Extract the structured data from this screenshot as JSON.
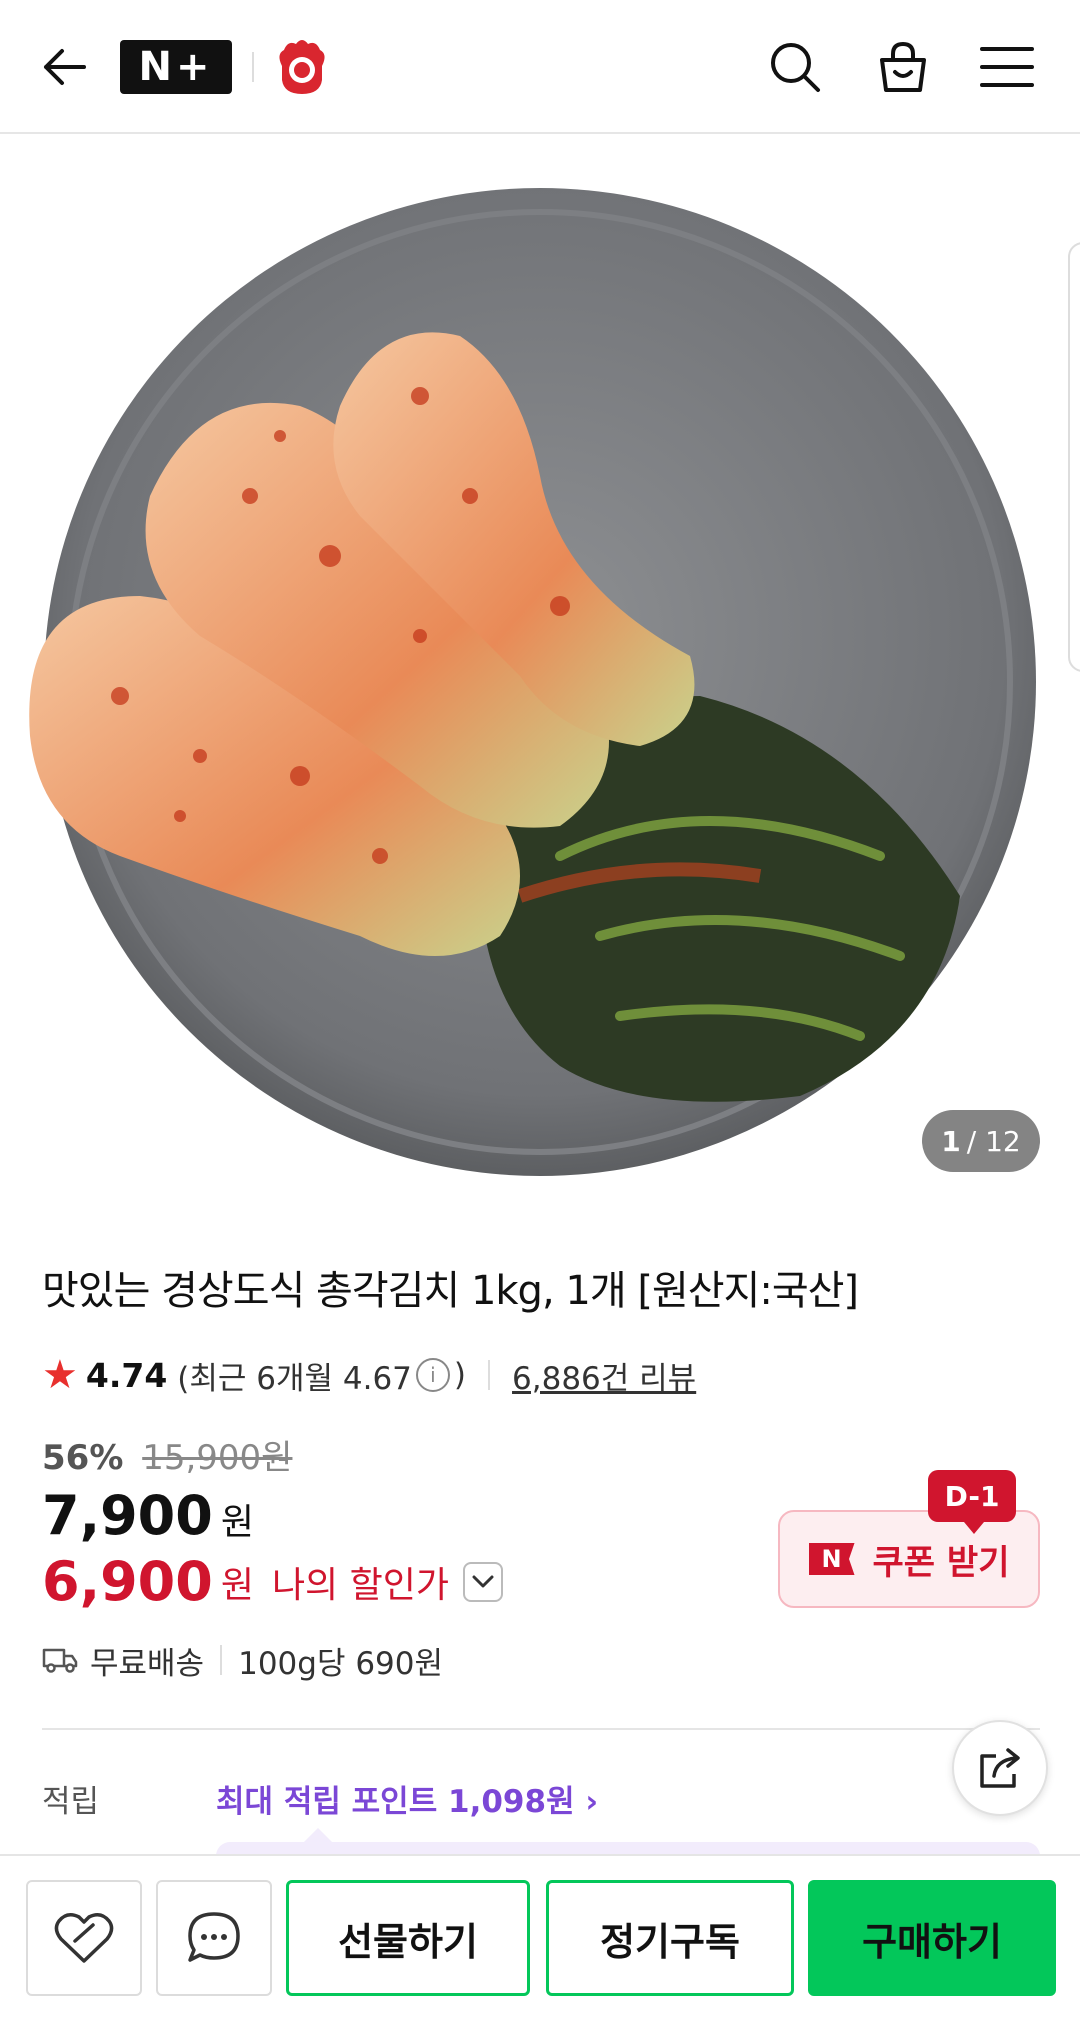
{
  "header": {
    "back_icon": "arrow-left-icon",
    "logo_text": "N+",
    "brand_logo": "brand-emblem-icon",
    "search_icon": "search-icon",
    "cart_icon": "shopping-bag-icon",
    "menu_icon": "hamburger-menu-icon"
  },
  "gallery": {
    "current": "1",
    "total": "/ 12"
  },
  "product": {
    "title": "맛있는 경상도식 총각김치 1kg, 1개 [원산지:국산]",
    "rating": {
      "star": "★",
      "score": "4.74",
      "recent_prefix": "(최근 6개월 4.67",
      "info": "i",
      "recent_suffix": ")",
      "reviews": "6,886건 리뷰"
    },
    "discount_pct": "56%",
    "original_price": "15,900원",
    "price": "7,900",
    "price_unit": "원",
    "my_price": "6,900",
    "my_price_unit": "원",
    "my_price_label": "나의 할인가",
    "coupon": {
      "badge": "D-1",
      "n_mark": "N",
      "label": "쿠폰 받기"
    },
    "shipping": {
      "label": "무료배송",
      "unit_price": "100g당 690원"
    },
    "points": {
      "label": "적립",
      "link": "최대 적립 포인트 1,098원 ›"
    }
  },
  "bottom_bar": {
    "wish_icon": "heart-outline-icon",
    "chat_icon": "chat-bubble-icon",
    "gift": "선물하기",
    "subscribe": "정기구독",
    "buy": "구매하기"
  },
  "colors": {
    "accent_green": "#03c75a",
    "sale_red": "#d0152e",
    "points_purple": "#7b47d6"
  }
}
